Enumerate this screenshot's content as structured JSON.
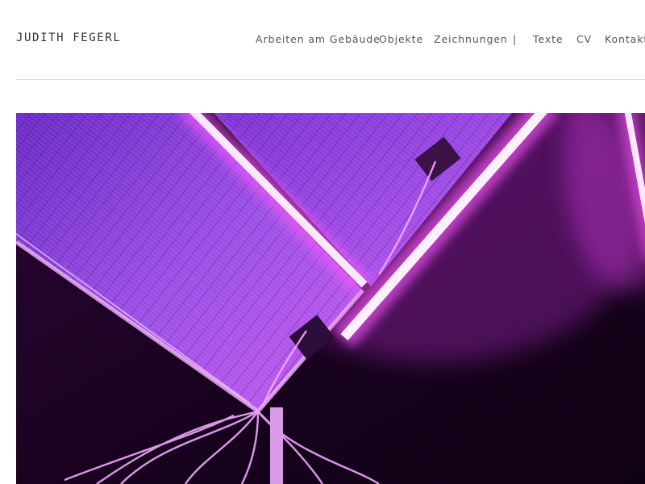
{
  "site": {
    "title": "JUDITH FEGERL"
  },
  "nav": {
    "items": [
      {
        "label": "Arbeiten am Gebäude"
      },
      {
        "label": "Objekte"
      },
      {
        "label": "Zeichnungen"
      },
      {
        "label": "|"
      },
      {
        "label": "Texte"
      },
      {
        "label": "CV"
      },
      {
        "label": "Kontakt"
      }
    ]
  },
  "hero": {
    "subject": "solar panels lit by pink neon tubes",
    "colors": {
      "background": "#1a0320",
      "panel": "#8a3fd6",
      "neon": "#ff6bff",
      "glow": "#ffd6ff"
    }
  }
}
